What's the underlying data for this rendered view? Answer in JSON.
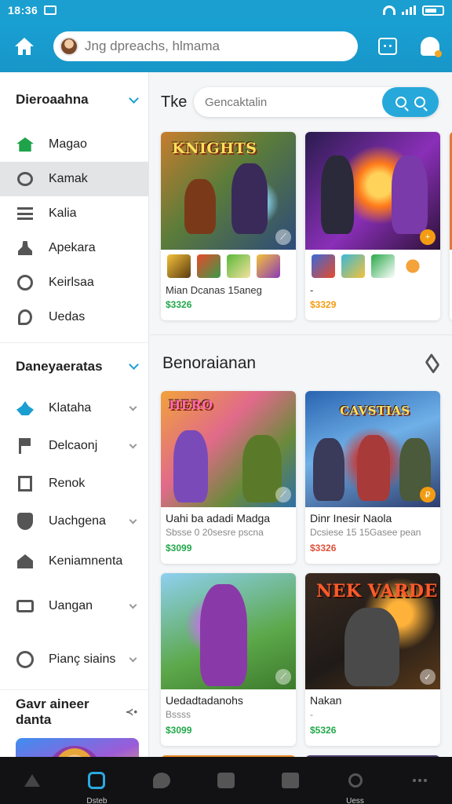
{
  "status": {
    "time": "18:36"
  },
  "header": {
    "search_placeholder": "Jng dpreachs, hlmama"
  },
  "sidebar": {
    "section1": "Dieroaahna",
    "items1": [
      {
        "label": "Magao"
      },
      {
        "label": "Kamak"
      },
      {
        "label": "Kalia"
      },
      {
        "label": "Apekara"
      },
      {
        "label": "Keirlsaa"
      },
      {
        "label": "Uedas"
      }
    ],
    "section2": "Daneyaeratas",
    "items2": [
      {
        "label": "Klataha"
      },
      {
        "label": "Delcaonj"
      },
      {
        "label": "Renok"
      },
      {
        "label": "Uachgena"
      },
      {
        "label": "Keniamnenta"
      },
      {
        "label": "Uangan"
      },
      {
        "label": "Pianç siains"
      }
    ],
    "footer": "Gavr aineer danta"
  },
  "main": {
    "title": "Tke",
    "search_placeholder": "Gencaktalin",
    "featured": [
      {
        "name": "Mian Dcanas 15aneg",
        "price": "$3326"
      },
      {
        "name": "-",
        "price": "$3329"
      }
    ],
    "art_logos": {
      "card1": "KNIGHTS",
      "grid1": "HERO",
      "grid2": "CAVSTIAS",
      "grid4": "NEK VARDE"
    },
    "section_title": "Benoraianan",
    "grid": [
      {
        "name": "Uahi ba adadi Madga",
        "sub": "Sbsse 0 20sesre pscna",
        "price": "$3099"
      },
      {
        "name": "Dinr Inesir Naola",
        "sub": "Dcsiese 15 15Gasee pean",
        "price": "$3326"
      },
      {
        "name": "Uedadtadanohs",
        "sub": "Bssss",
        "price": "$3099"
      },
      {
        "name": "Nakan",
        "sub": "-",
        "price": "$5326"
      }
    ]
  },
  "bottom_nav": {
    "active_label": "Dsteb",
    "search_label": "Uess"
  }
}
